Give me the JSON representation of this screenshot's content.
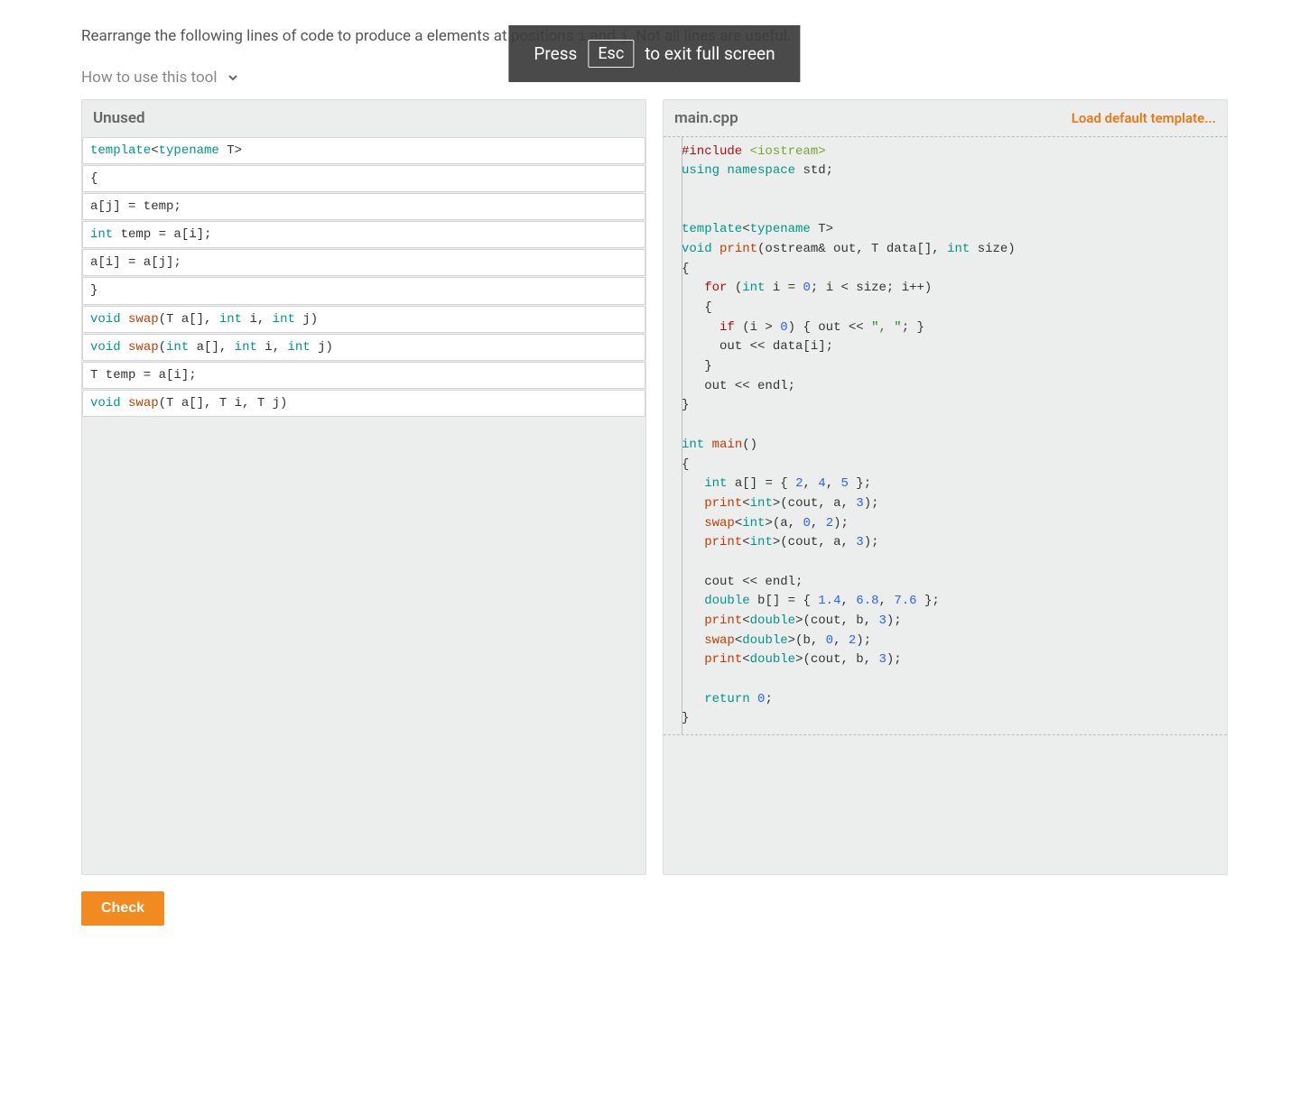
{
  "fs_notice": {
    "pre": "Press",
    "key": "Esc",
    "post": "to exit full screen"
  },
  "instruction": {
    "pre": "Rearrange the following lines of code to produce a ",
    "mid": "elements at positions ",
    "and": " and ",
    "post": ". Not all lines are useful.",
    "var_i": "i",
    "var_j": "j"
  },
  "howto_label": "How to use this tool",
  "unused": {
    "header": "Unused",
    "tiles": [
      [
        {
          "t": "template",
          "c": "kw"
        },
        {
          "t": "<"
        },
        {
          "t": "typename",
          "c": "kw"
        },
        {
          "t": " T>"
        }
      ],
      [
        {
          "t": "{"
        }
      ],
      [
        {
          "t": "a[j] = temp;"
        }
      ],
      [
        {
          "t": "int",
          "c": "kw"
        },
        {
          "t": " temp = a[i];"
        }
      ],
      [
        {
          "t": "a[i] = a[j];"
        }
      ],
      [
        {
          "t": "}"
        }
      ],
      [
        {
          "t": "void",
          "c": "kw"
        },
        {
          "t": " "
        },
        {
          "t": "swap",
          "c": "fn"
        },
        {
          "t": "(T a[], "
        },
        {
          "t": "int",
          "c": "kw"
        },
        {
          "t": " i, "
        },
        {
          "t": "int",
          "c": "kw"
        },
        {
          "t": " j)"
        }
      ],
      [
        {
          "t": "void",
          "c": "kw"
        },
        {
          "t": " "
        },
        {
          "t": "swap",
          "c": "fn"
        },
        {
          "t": "("
        },
        {
          "t": "int",
          "c": "kw"
        },
        {
          "t": " a[], "
        },
        {
          "t": "int",
          "c": "kw"
        },
        {
          "t": " i, "
        },
        {
          "t": "int",
          "c": "kw"
        },
        {
          "t": " j)"
        }
      ],
      [
        {
          "t": "T temp = a[i];"
        }
      ],
      [
        {
          "t": "void",
          "c": "kw"
        },
        {
          "t": " "
        },
        {
          "t": "swap",
          "c": "fn"
        },
        {
          "t": "(T a[], T i, T j)"
        }
      ]
    ]
  },
  "main": {
    "header": "main.cpp",
    "load_link": "Load default template...",
    "code": [
      [
        {
          "t": "#include",
          "c": "kw2"
        },
        {
          "t": " "
        },
        {
          "t": "<iostream>",
          "c": "lib"
        }
      ],
      [
        {
          "t": "using",
          "c": "kw"
        },
        {
          "t": " "
        },
        {
          "t": "namespace",
          "c": "kw"
        },
        {
          "t": " std;"
        }
      ],
      [
        {
          "t": ""
        }
      ],
      [
        {
          "t": ""
        }
      ],
      [
        {
          "t": "template",
          "c": "kw"
        },
        {
          "t": "<"
        },
        {
          "t": "typename",
          "c": "kw"
        },
        {
          "t": " T>"
        }
      ],
      [
        {
          "t": "void",
          "c": "kw"
        },
        {
          "t": " "
        },
        {
          "t": "print",
          "c": "fn"
        },
        {
          "t": "(ostream& out, T data[], "
        },
        {
          "t": "int",
          "c": "kw"
        },
        {
          "t": " size)"
        }
      ],
      [
        {
          "t": "{"
        }
      ],
      [
        {
          "t": "   "
        },
        {
          "t": "for",
          "c": "kw2"
        },
        {
          "t": " ("
        },
        {
          "t": "int",
          "c": "kw"
        },
        {
          "t": " i = "
        },
        {
          "t": "0",
          "c": "num"
        },
        {
          "t": "; i < size; i++)"
        }
      ],
      [
        {
          "t": "   {"
        }
      ],
      [
        {
          "t": "     "
        },
        {
          "t": "if",
          "c": "kw2"
        },
        {
          "t": " (i > "
        },
        {
          "t": "0",
          "c": "num"
        },
        {
          "t": ") { out << "
        },
        {
          "t": "\", \"",
          "c": "str"
        },
        {
          "t": "; }"
        }
      ],
      [
        {
          "t": "     out << data[i];"
        }
      ],
      [
        {
          "t": "   }"
        }
      ],
      [
        {
          "t": "   out << endl;"
        }
      ],
      [
        {
          "t": "}"
        }
      ],
      [
        {
          "t": ""
        }
      ],
      [
        {
          "t": "int",
          "c": "kw"
        },
        {
          "t": " "
        },
        {
          "t": "main",
          "c": "fn"
        },
        {
          "t": "()"
        }
      ],
      [
        {
          "t": "{"
        }
      ],
      [
        {
          "t": "   "
        },
        {
          "t": "int",
          "c": "kw"
        },
        {
          "t": " a[] = { "
        },
        {
          "t": "2",
          "c": "num"
        },
        {
          "t": ", "
        },
        {
          "t": "4",
          "c": "num"
        },
        {
          "t": ", "
        },
        {
          "t": "5",
          "c": "num"
        },
        {
          "t": " };"
        }
      ],
      [
        {
          "t": "   "
        },
        {
          "t": "print",
          "c": "fn"
        },
        {
          "t": "<"
        },
        {
          "t": "int",
          "c": "kw"
        },
        {
          "t": ">(cout, a, "
        },
        {
          "t": "3",
          "c": "num"
        },
        {
          "t": ");"
        }
      ],
      [
        {
          "t": "   "
        },
        {
          "t": "swap",
          "c": "fn"
        },
        {
          "t": "<"
        },
        {
          "t": "int",
          "c": "kw"
        },
        {
          "t": ">(a, "
        },
        {
          "t": "0",
          "c": "num"
        },
        {
          "t": ", "
        },
        {
          "t": "2",
          "c": "num"
        },
        {
          "t": ");"
        }
      ],
      [
        {
          "t": "   "
        },
        {
          "t": "print",
          "c": "fn"
        },
        {
          "t": "<"
        },
        {
          "t": "int",
          "c": "kw"
        },
        {
          "t": ">(cout, a, "
        },
        {
          "t": "3",
          "c": "num"
        },
        {
          "t": ");"
        }
      ],
      [
        {
          "t": ""
        }
      ],
      [
        {
          "t": "   cout << endl;"
        }
      ],
      [
        {
          "t": "   "
        },
        {
          "t": "double",
          "c": "kw"
        },
        {
          "t": " b[] = { "
        },
        {
          "t": "1.4",
          "c": "num"
        },
        {
          "t": ", "
        },
        {
          "t": "6.8",
          "c": "num"
        },
        {
          "t": ", "
        },
        {
          "t": "7.6",
          "c": "num"
        },
        {
          "t": " };"
        }
      ],
      [
        {
          "t": "   "
        },
        {
          "t": "print",
          "c": "fn"
        },
        {
          "t": "<"
        },
        {
          "t": "double",
          "c": "kw"
        },
        {
          "t": ">(cout, b, "
        },
        {
          "t": "3",
          "c": "num"
        },
        {
          "t": ");"
        }
      ],
      [
        {
          "t": "   "
        },
        {
          "t": "swap",
          "c": "fn"
        },
        {
          "t": "<"
        },
        {
          "t": "double",
          "c": "kw"
        },
        {
          "t": ">(b, "
        },
        {
          "t": "0",
          "c": "num"
        },
        {
          "t": ", "
        },
        {
          "t": "2",
          "c": "num"
        },
        {
          "t": ");"
        }
      ],
      [
        {
          "t": "   "
        },
        {
          "t": "print",
          "c": "fn"
        },
        {
          "t": "<"
        },
        {
          "t": "double",
          "c": "kw"
        },
        {
          "t": ">(cout, b, "
        },
        {
          "t": "3",
          "c": "num"
        },
        {
          "t": ");"
        }
      ],
      [
        {
          "t": ""
        }
      ],
      [
        {
          "t": "   "
        },
        {
          "t": "return",
          "c": "kw"
        },
        {
          "t": " "
        },
        {
          "t": "0",
          "c": "num"
        },
        {
          "t": ";"
        }
      ],
      [
        {
          "t": "}"
        }
      ]
    ]
  },
  "check_label": "Check"
}
